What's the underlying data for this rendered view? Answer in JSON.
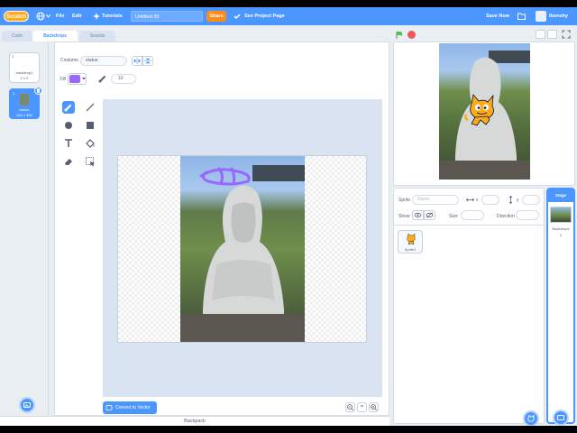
{
  "menu": {
    "logo": "Scratch",
    "file": "File",
    "edit": "Edit",
    "tutorials": "Tutorials",
    "project_title": "Untitled-35",
    "share": "Share",
    "see_project_page": "See Project Page",
    "save_now": "Save Now",
    "username": "tbenshy"
  },
  "tabs": {
    "code": "Code",
    "backdrops": "Backdrops",
    "sounds": "Sounds"
  },
  "costumes": [
    {
      "index": "1",
      "name": "backdrop1",
      "size": "2 x 2"
    },
    {
      "index": "2",
      "name": "statue",
      "size": "240 x 360"
    }
  ],
  "paint": {
    "costume_label": "Costume",
    "costume_name": "statue",
    "fill_label": "Fill",
    "fill_color": "#9966ff",
    "brush_size": "10",
    "convert_button": "Convert to Vector",
    "zoom_reset": "="
  },
  "sprite_info": {
    "sprite_label": "Sprite",
    "sprite_placeholder": "Name",
    "x_label": "x",
    "y_label": "y",
    "show_label": "Show",
    "size_label": "Size",
    "direction_label": "Direction"
  },
  "sprites": [
    {
      "name": "Sprite1"
    }
  ],
  "stage_selector": {
    "title": "Stage",
    "backdrops_label": "Backdrops",
    "backdrops_count": "2"
  },
  "backpack": "Backpack",
  "colors": {
    "accent": "#4c97ff",
    "share": "#ff8c1a",
    "fill": "#9966ff",
    "green_flag": "#4cbf56",
    "stop": "#ec5959"
  }
}
